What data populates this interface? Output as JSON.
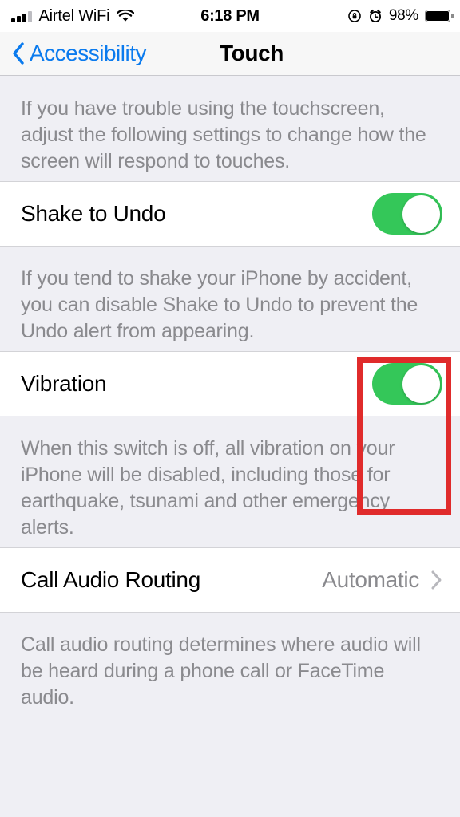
{
  "status_bar": {
    "carrier": "Airtel WiFi",
    "signal_icon": "signal-bars-icon",
    "wifi_icon": "wifi-icon",
    "time": "6:18 PM",
    "rotation_lock_icon": "rotation-lock-icon",
    "alarm_icon": "alarm-clock-icon",
    "battery_percent": "98%",
    "battery_icon": "battery-full-icon"
  },
  "nav_bar": {
    "back_icon": "chevron-left-icon",
    "back_label": "Accessibility",
    "title": "Touch"
  },
  "sections": {
    "intro_footer": "If you have trouble using the touchscreen, adjust the following settings to change how the screen will respond to touches.",
    "shake_to_undo": {
      "label": "Shake to Undo",
      "toggle_state": "on",
      "footer": "If you tend to shake your iPhone by accident, you can disable Shake to Undo to prevent the Undo alert from appearing."
    },
    "vibration": {
      "label": "Vibration",
      "toggle_state": "on",
      "footer": "When this switch is off, all vibration on your iPhone will be disabled, including those for earthquake, tsunami and other emergency alerts."
    },
    "call_audio_routing": {
      "label": "Call Audio Routing",
      "value": "Automatic",
      "chevron_icon": "chevron-right-icon",
      "footer": "Call audio routing determines where audio will be heard during a phone call or FaceTime audio."
    }
  },
  "annotation": {
    "shape": "rectangle",
    "color": "#E02B2B",
    "target": "vibration-toggle"
  },
  "colors": {
    "toggle_on": "#34C759",
    "link_blue": "#0B7BEE",
    "footer_gray": "#8A8A8E",
    "group_background": "#EFEFF4",
    "row_background": "#FFFFFF",
    "annotation_red": "#E02B2B"
  }
}
